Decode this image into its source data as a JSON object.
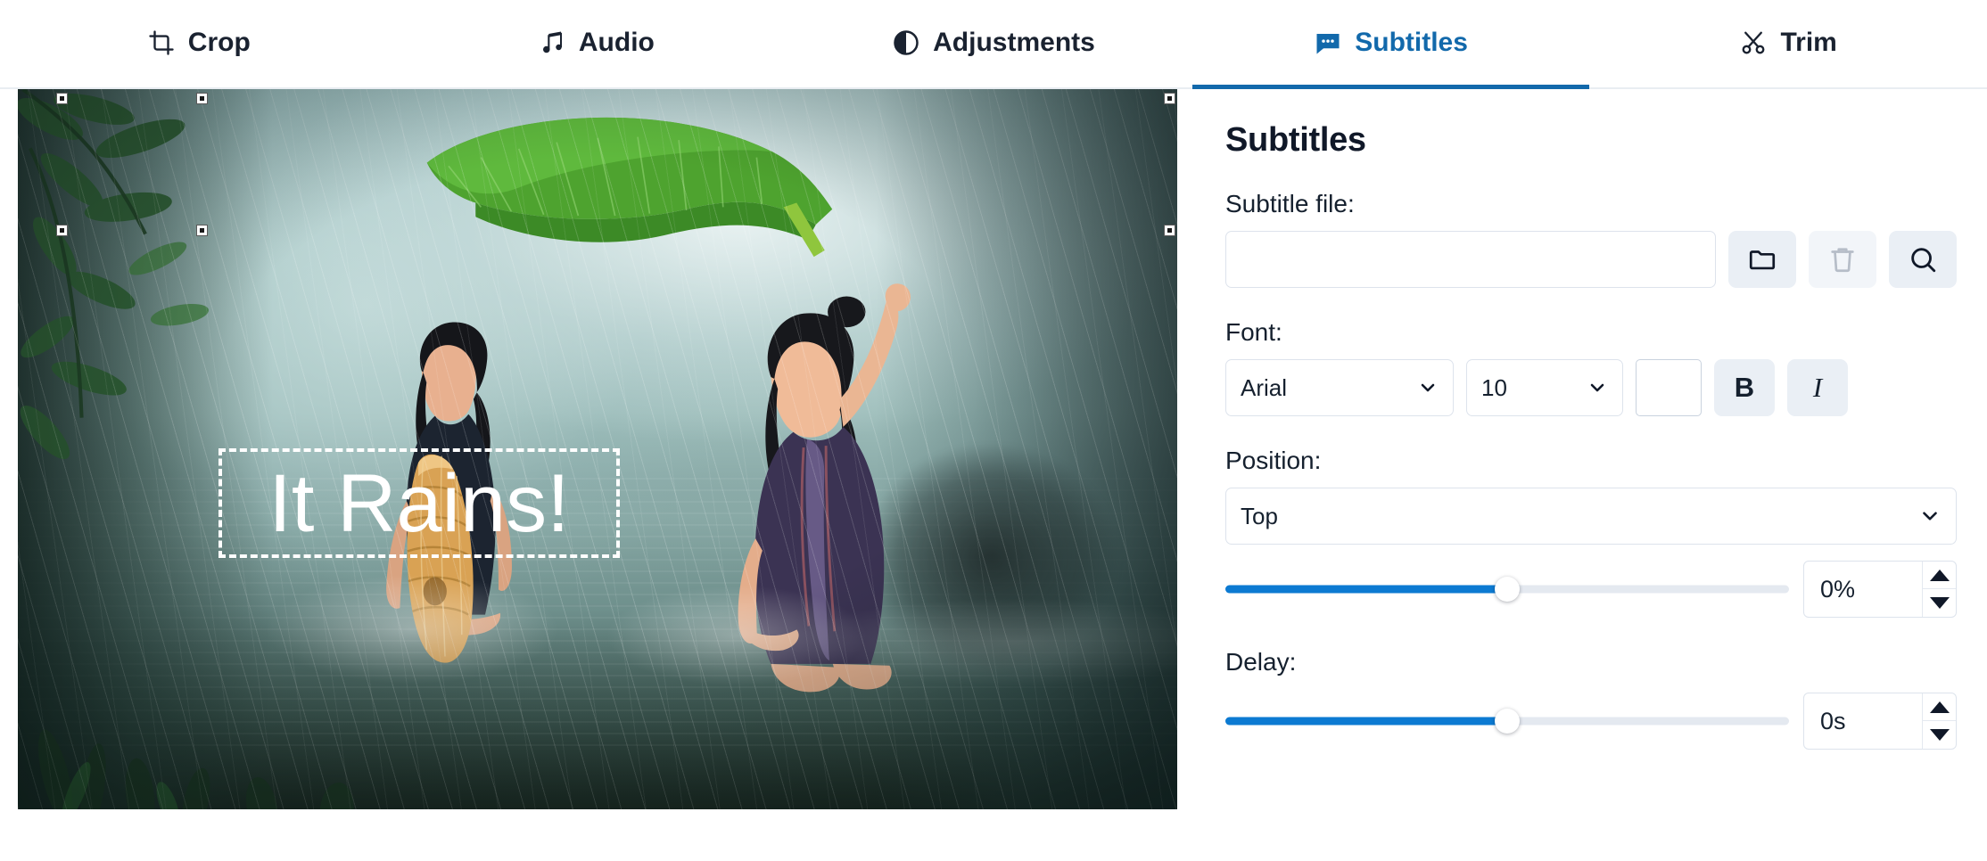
{
  "tabs": [
    {
      "id": "crop",
      "label": "Crop",
      "icon": "crop-icon",
      "active": false
    },
    {
      "id": "audio",
      "label": "Audio",
      "icon": "music-note-icon",
      "active": false
    },
    {
      "id": "adjustments",
      "label": "Adjustments",
      "icon": "contrast-icon",
      "active": false
    },
    {
      "id": "subtitles",
      "label": "Subtitles",
      "icon": "comment-dots-icon",
      "active": true
    },
    {
      "id": "trim",
      "label": "Trim",
      "icon": "scissors-icon",
      "active": false
    }
  ],
  "preview": {
    "subtitle_overlay_text": "It Rains!",
    "handles": [
      "top-left",
      "top-center",
      "top-right",
      "middle-left",
      "middle-center",
      "middle-right"
    ]
  },
  "panel": {
    "title": "Subtitles",
    "subtitle_file": {
      "label": "Subtitle file:",
      "value": "",
      "placeholder": "",
      "browse_icon": "folder-icon",
      "delete_icon": "trash-icon",
      "search_icon": "magnifier-icon"
    },
    "font": {
      "label": "Font:",
      "family": "Arial",
      "size": "10",
      "color": "#ffffff",
      "bold_label": "B",
      "italic_label": "I",
      "family_options": [
        "Arial"
      ],
      "size_options": [
        "10"
      ]
    },
    "position": {
      "label": "Position:",
      "value": "Top",
      "options": [
        "Top"
      ],
      "offset_display": "0%",
      "offset_percent": 50
    },
    "delay": {
      "label": "Delay:",
      "value_display": "0s",
      "slider_percent": 50
    }
  },
  "colors": {
    "accent": "#1269ab",
    "slider_fill": "#0c7ad2",
    "text": "#15202e",
    "button_bg": "#eaeff5",
    "border": "#dde3ec"
  }
}
